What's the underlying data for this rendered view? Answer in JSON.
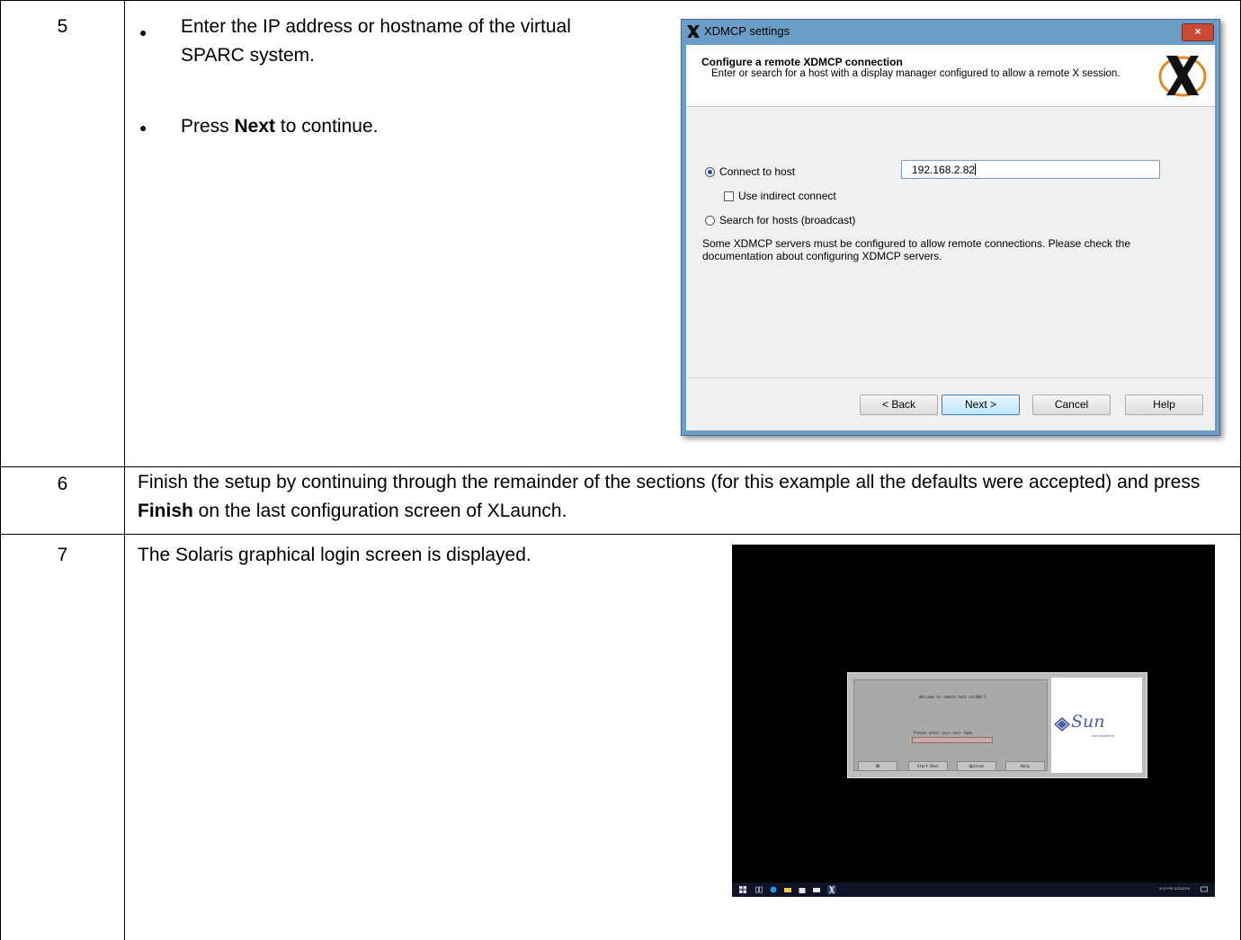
{
  "rows": [
    {
      "step": "5",
      "bullets": [
        {
          "parts": [
            {
              "text": "Enter the IP address or hostname of the virtual SPARC system.",
              "bold": false
            }
          ]
        },
        {
          "parts": [
            {
              "text": "Press ",
              "bold": false
            },
            {
              "text": "Next",
              "bold": true
            },
            {
              "text": " to continue.",
              "bold": false
            }
          ]
        }
      ]
    },
    {
      "step": "6",
      "parts": [
        {
          "text": "Finish the setup by continuing through the remainder of the sections (for this example all the defaults were accepted) and press ",
          "bold": false
        },
        {
          "text": "Finish",
          "bold": true
        },
        {
          "text": " on the last configuration screen of XLaunch.",
          "bold": false
        }
      ]
    },
    {
      "step": "7",
      "text": "The Solaris graphical login screen is displayed."
    }
  ],
  "xdmcp_dialog": {
    "title": "XDMCP settings",
    "close_label": "×",
    "header_title": "Configure a remote XDMCP connection",
    "header_desc": "Enter or search for a host with a display manager configured to allow a remote X session.",
    "connect_label": "Connect to host",
    "connect_selected": true,
    "host_value": "192.168.2.82",
    "indirect_label": "Use indirect connect",
    "indirect_checked": false,
    "search_label": "Search for hosts (broadcast)",
    "search_selected": false,
    "note": "Some XDMCP servers must be configured to allow remote connections. Please check the documentation about configuring XDMCP servers.",
    "buttons": {
      "back": "< Back",
      "next": "Next >",
      "cancel": "Cancel",
      "help": "Help"
    }
  },
  "solaris_login": {
    "welcome": "Welcome to remote host ent480-1",
    "prompt": "Please enter your user name",
    "buttons": [
      "OK",
      "Start Over",
      "Options",
      "Help"
    ],
    "logo": "Sun",
    "logo_sub": "microsystems",
    "clock_time": "6:13 PM",
    "clock_date": "1/22/2019"
  }
}
